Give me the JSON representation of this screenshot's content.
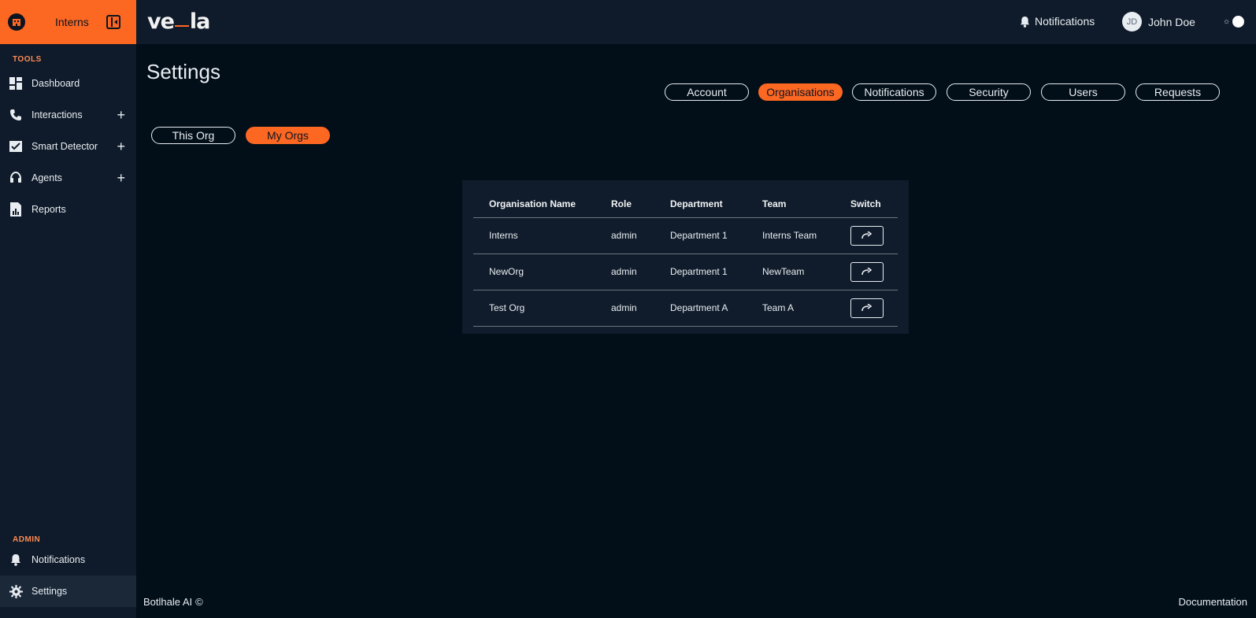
{
  "sidebar": {
    "org_name": "Interns",
    "tools_label": "TOOLS",
    "admin_label": "ADMIN",
    "tools": [
      {
        "label": "Dashboard",
        "icon": "dashboard-icon"
      },
      {
        "label": "Interactions",
        "icon": "phone-icon",
        "expandable": true
      },
      {
        "label": "Smart Detector",
        "icon": "check-chart-icon",
        "expandable": true
      },
      {
        "label": "Agents",
        "icon": "headset-icon",
        "expandable": true
      },
      {
        "label": "Reports",
        "icon": "report-icon"
      }
    ],
    "admin": [
      {
        "label": "Notifications",
        "icon": "bell-icon"
      },
      {
        "label": "Settings",
        "icon": "gear-icon",
        "active": true
      }
    ]
  },
  "topbar": {
    "logo_left": "ve",
    "logo_right": "la",
    "notifications_label": "Notifications",
    "user_initials": "JD",
    "user_name": "John Doe"
  },
  "page": {
    "title": "Settings",
    "tabs": [
      "Account",
      "Organisations",
      "Notifications",
      "Security",
      "Users",
      "Requests"
    ],
    "active_tab": "Organisations",
    "subtabs": [
      "This Org",
      "My Orgs"
    ],
    "active_subtab": "My Orgs"
  },
  "table": {
    "headers": [
      "Organisation Name",
      "Role",
      "Department",
      "Team",
      "Switch"
    ],
    "rows": [
      [
        "Interns",
        "admin",
        "Department 1",
        "Interns Team"
      ],
      [
        "NewOrg",
        "admin",
        "Department 1",
        "NewTeam"
      ],
      [
        "Test Org",
        "admin",
        "Department A",
        "Team A"
      ]
    ]
  },
  "footer": {
    "company": "Botlhale AI",
    "copyright_symbol": "©",
    "documentation": "Documentation"
  },
  "colors": {
    "accent": "#fc6722",
    "background": "#020e18",
    "panel": "#0f1b2a"
  }
}
